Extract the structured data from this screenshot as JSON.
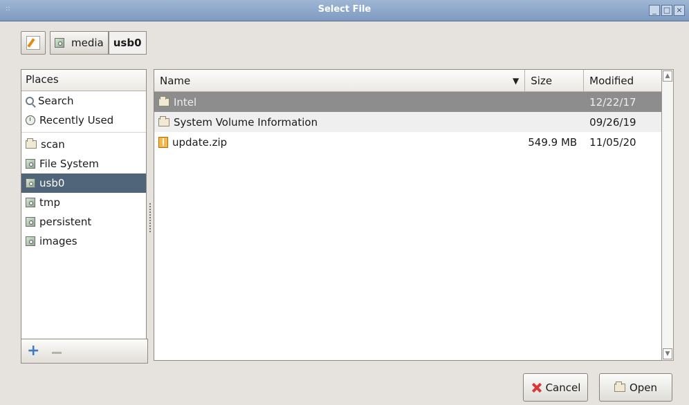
{
  "window": {
    "title": "Select File",
    "controls": [
      "minimize",
      "maximize",
      "close"
    ]
  },
  "path_bar": {
    "buttons": [
      "media",
      "usb0"
    ],
    "active": "usb0"
  },
  "places": {
    "header": "Places",
    "items": [
      {
        "label": "Search",
        "icon": "search-icon"
      },
      {
        "label": "Recently Used",
        "icon": "recent-icon"
      },
      {
        "label": "scan",
        "icon": "folder-icon"
      },
      {
        "label": "File System",
        "icon": "disk-icon"
      },
      {
        "label": "usb0",
        "icon": "disk-icon",
        "selected": true
      },
      {
        "label": "tmp",
        "icon": "disk-icon"
      },
      {
        "label": "persistent",
        "icon": "disk-icon"
      },
      {
        "label": "images",
        "icon": "disk-icon"
      }
    ]
  },
  "files": {
    "columns": [
      "Name",
      "Size",
      "Modified"
    ],
    "rows": [
      {
        "name": "Intel",
        "size": "",
        "modified": "12/22/17",
        "icon": "folder-icon",
        "selected": true
      },
      {
        "name": "System Volume Information",
        "size": "",
        "modified": "09/26/19",
        "icon": "folder-icon"
      },
      {
        "name": "update.zip",
        "size": "549.9 MB",
        "modified": "11/05/20",
        "icon": "zip-icon"
      }
    ]
  },
  "buttons": {
    "cancel": "Cancel",
    "open": "Open"
  }
}
